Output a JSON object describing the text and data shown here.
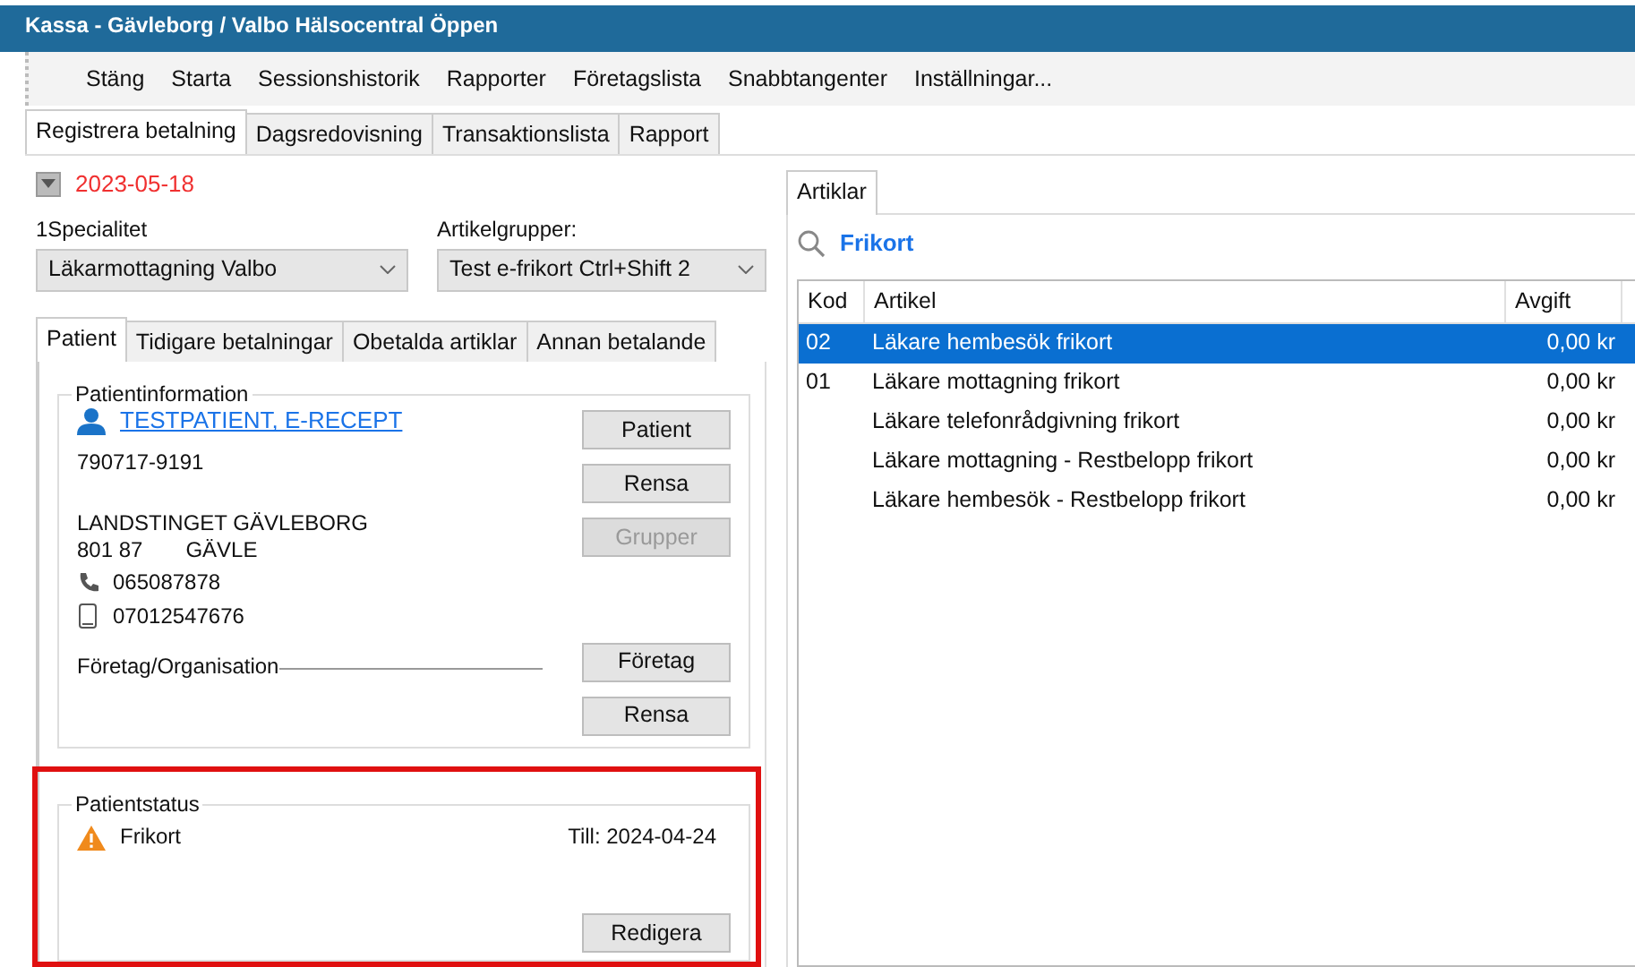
{
  "window": {
    "title": "Kassa - Gävleborg / Valbo Hälsocentral Öppen"
  },
  "menu": [
    "Stäng",
    "Starta",
    "Sessionshistorik",
    "Rapporter",
    "Företagslista",
    "Snabbtangenter",
    "Inställningar..."
  ],
  "tabs": [
    {
      "label": "Registrera betalning",
      "selected": true
    },
    {
      "label": "Dagsredovisning",
      "selected": false
    },
    {
      "label": "Transaktionslista",
      "selected": false
    },
    {
      "label": "Rapport",
      "selected": false
    }
  ],
  "date": {
    "value": "2023-05-18"
  },
  "filters": [
    {
      "label": "1Specialitet",
      "value": "Läkarmottagning Valbo"
    },
    {
      "label": "Artikelgrupper:",
      "value": "Test e-frikort Ctrl+Shift 2"
    }
  ],
  "patient_tabs": [
    {
      "label": "Patient",
      "selected": true
    },
    {
      "label": "Tidigare betalningar",
      "selected": false
    },
    {
      "label": "Obetalda artiklar",
      "selected": false
    },
    {
      "label": "Annan betalande",
      "selected": false
    }
  ],
  "patient_info": {
    "title": "Patientinformation",
    "name": "TESTPATIENT, E-RECEPT",
    "id": "790717-9191",
    "address": "LANDSTINGET GÄVLEBORG",
    "postal_code": "801 87",
    "city": "GÄVLE",
    "phone": "065087878",
    "mobile": "07012547676",
    "organisation_label": "Företag/Organisation",
    "buttons": [
      {
        "label": "Patient",
        "disabled": false
      },
      {
        "label": "Rensa",
        "disabled": false
      },
      {
        "label": "Grupper",
        "disabled": true
      }
    ],
    "organisation_buttons": [
      {
        "label": "Företag",
        "disabled": false
      },
      {
        "label": "Rensa",
        "disabled": false
      }
    ]
  },
  "patient_status": {
    "title": "Patientstatus",
    "highlighted": true,
    "items": [
      {
        "label": "Frikort",
        "until": "Till: 2024-04-24"
      }
    ],
    "buttons": [
      {
        "label": "Redigera",
        "disabled": false
      }
    ]
  },
  "articles": {
    "tabs": [
      {
        "label": "Artiklar",
        "selected": true
      }
    ],
    "search": {
      "value": "Frikort"
    },
    "columns": [
      "Kod",
      "Artikel",
      "Avgift"
    ],
    "rows": [
      {
        "code": "02",
        "article": "Läkare hembesök frikort",
        "fee": "0,00 kr",
        "selected": true
      },
      {
        "code": "01",
        "article": "Läkare mottagning frikort",
        "fee": "0,00 kr",
        "selected": false
      },
      {
        "code": "",
        "article": "Läkare telefonrådgivning frikort",
        "fee": "0,00 kr",
        "selected": false
      },
      {
        "code": "",
        "article": "Läkare mottagning - Restbelopp frikort",
        "fee": "0,00 kr",
        "selected": false
      },
      {
        "code": "",
        "article": "Läkare hembesök - Restbelopp frikort",
        "fee": "0,00 kr",
        "selected": false
      }
    ]
  }
}
